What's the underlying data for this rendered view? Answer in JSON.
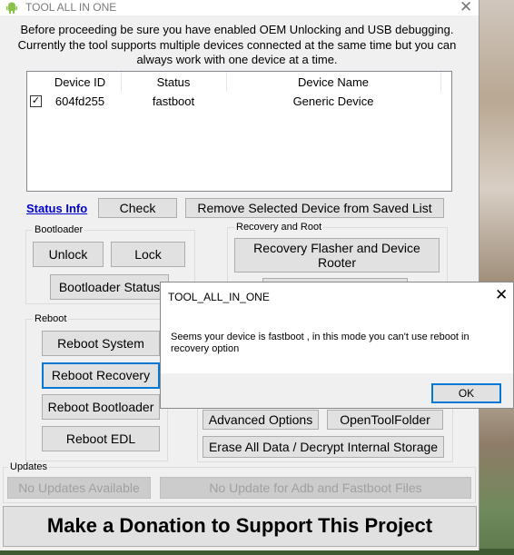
{
  "window": {
    "title": "TOOL ALL IN ONE"
  },
  "intro": {
    "line1": "Before proceeding be sure you have enabled OEM Unlocking and USB debugging.",
    "line2": "Currently the tool supports multiple devices connected at the same time but you can",
    "line3": "always work with one device at a time."
  },
  "devices": {
    "columns": [
      "Device ID",
      "Status",
      "Device Name"
    ],
    "rows": [
      {
        "checked": true,
        "id": "604fd255",
        "status": "fastboot",
        "name": "Generic Device"
      }
    ]
  },
  "toolbar": {
    "status_info": "Status Info",
    "check": "Check",
    "remove": "Remove Selected Device from Saved List"
  },
  "bootloader": {
    "label": "Bootloader",
    "unlock": "Unlock",
    "lock": "Lock",
    "status": "Bootloader Status"
  },
  "recovery": {
    "label": "Recovery and Root",
    "flasher_line1": "Recovery Flasher and Device",
    "flasher_line2": "Rooter"
  },
  "reboot": {
    "label": "Reboot",
    "system": "Reboot System",
    "recovery": "Reboot Recovery",
    "bootloader": "Reboot Bootloader",
    "edl": "Reboot EDL"
  },
  "misc": {
    "advanced": "Advanced Options",
    "open_folder": "OpenToolFolder",
    "erase": "Erase All Data / Decrypt Internal Storage"
  },
  "updates": {
    "label": "Updates",
    "none": "No Updates Available",
    "adb": "No Update for Adb and Fastboot Files"
  },
  "donate": "Make a Donation to Support This Project",
  "dialog": {
    "title": "TOOL_ALL_IN_ONE",
    "message_line1": "Seems your device is fastboot , in this mode you can't use reboot in",
    "message_line2": "recovery option",
    "ok": "OK"
  },
  "colors": {
    "focus": "#0078d7",
    "link": "#0000cc"
  }
}
